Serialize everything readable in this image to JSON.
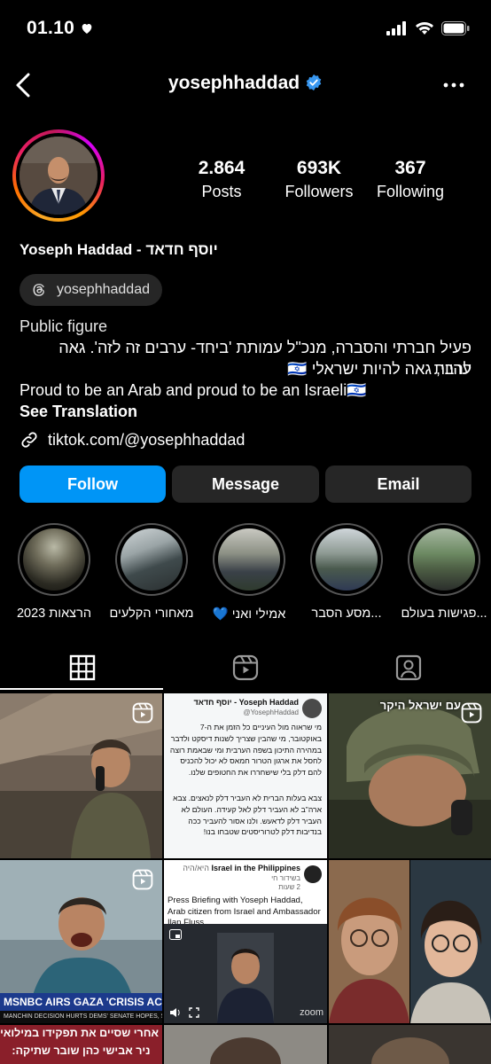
{
  "status": {
    "time": "01.10"
  },
  "nav": {
    "username": "yosephhaddad"
  },
  "stats": [
    {
      "value": "2.864",
      "label": "Posts"
    },
    {
      "value": "693K",
      "label": "Followers"
    },
    {
      "value": "367",
      "label": "Following"
    }
  ],
  "profile": {
    "full_name": "Yoseph Haddad - יוסף חדאד",
    "threads_handle": "yosephhaddad",
    "category": "Public figure",
    "bio_he_line1": "פעיל חברתי והסברה, מנכ\"ל עמותת 'ביחד- ערבים זה לזה'. גאה להיות",
    "bio_he_line2": "ערבי, גאה להיות ישראלי 🇮🇱",
    "bio_en": "Proud to be an Arab and proud to be an Israeli🇮🇱",
    "see_translation": "See Translation",
    "link": "tiktok.com/@yosephhaddad"
  },
  "actions": {
    "follow": "Follow",
    "message": "Message",
    "email": "Email"
  },
  "highlights": [
    {
      "label": "הרצאות 2023"
    },
    {
      "label": "מאחורי הקלעים"
    },
    {
      "label": "💙 אמילי ואני"
    },
    {
      "label": "מסע הסבר..."
    },
    {
      "label": "פגישות בעולם..."
    }
  ],
  "posts": {
    "tweet": {
      "author": "Yoseph Haddad - יוסף חדאד",
      "handle": "@YosephHaddad",
      "text": "מי שראוה מול העיניים כל הזמן את ה-7 באוקטובר, מי שהבין שצריך לשנות דיסקט ולדבר במהירה התיכון בשפה הערבית ומי שבאמת רוצה לחסל את ארגון הטרור חמאס לא יכול להכניס להם דלק בלי שישחררו את החטופים שלנו.",
      "text2": "צבא בעלות הברית לא העביר דלק לנאצים. צבא ארה\"ב לא העביר דלק לאל קעידה. העולם לא העביר דלק לדאעש. ולנו אסור להעביר ככה בנדיבות דלק לטרוריסטים שטבחו בנו!"
    },
    "soldier_caption": "עם ישראל היקר",
    "msnbc_caption": "MSNBC AIRS GAZA 'CRISIS AC",
    "msnbc_sub": "MANCHIN DECISION HURTS DEMS' SENATE HOPES, SPARKS",
    "fb": {
      "page": "Israel in the Philippines",
      "meta_he": "היא/היה",
      "sub": "בשידור חי",
      "time": "2 שעות",
      "text": "Press Briefing with Yoseph Haddad, Arab citizen from Israel and Ambassador Ilan Fluss",
      "zoom": "zoom"
    },
    "bottom_caption1": "אחרי שסיים את תפקידו במילואים -",
    "bottom_caption2": "ניר אבישי כהן שובר שתיקה:"
  },
  "colors": {
    "accent": "#0095f6",
    "button_dark": "#262626",
    "verified": "#3897f0"
  }
}
